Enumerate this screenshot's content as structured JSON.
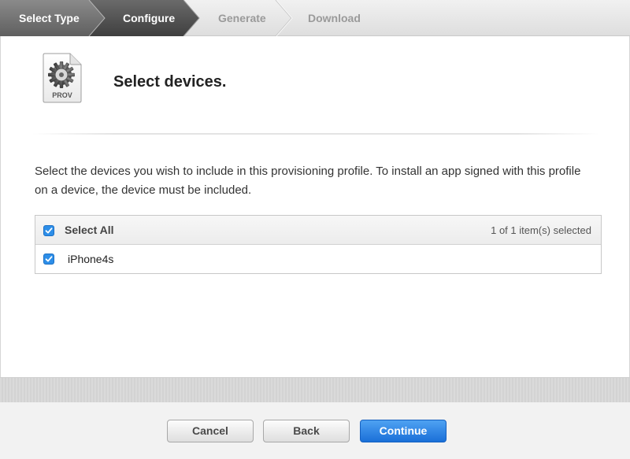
{
  "wizard": {
    "steps": [
      {
        "label": "Select Type",
        "state": "done"
      },
      {
        "label": "Configure",
        "state": "current"
      },
      {
        "label": "Generate",
        "state": "todo"
      },
      {
        "label": "Download",
        "state": "todo"
      }
    ]
  },
  "header": {
    "icon_label": "PROV",
    "icon": "provisioning-profile-icon",
    "title": "Select devices."
  },
  "intro_text": "Select the devices you wish to include in this provisioning profile. To install an app signed with this profile on a device, the device must be included.",
  "device_table": {
    "select_all_label": "Select All",
    "select_all_checked": true,
    "selection_count": "1 of 1 item(s) selected",
    "devices": [
      {
        "name": "iPhone4s",
        "checked": true
      }
    ]
  },
  "footer": {
    "cancel_label": "Cancel",
    "back_label": "Back",
    "continue_label": "Continue"
  },
  "colors": {
    "step_done": "#6d6d6d",
    "step_current": "#4a4a4a",
    "checkbox": "#2d8ee8",
    "primary_button": "#2a7fe0"
  }
}
